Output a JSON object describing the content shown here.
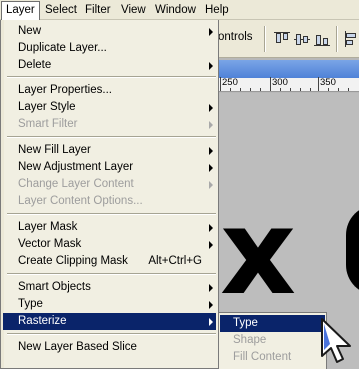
{
  "menubar": {
    "items": [
      {
        "label": "Layer",
        "active": true
      },
      {
        "label": "Select"
      },
      {
        "label": "Filter"
      },
      {
        "label": "View"
      },
      {
        "label": "Window"
      },
      {
        "label": "Help"
      }
    ]
  },
  "optionsbar": {
    "label": "ontrols",
    "align_icons": [
      "align-top-edges-icon",
      "align-vertical-centers-icon",
      "align-bottom-edges-icon",
      "align-left-edges-icon"
    ]
  },
  "ruler": {
    "labels": [
      "250",
      "300",
      "350"
    ]
  },
  "canvas": {
    "text": "x"
  },
  "layer_menu": {
    "items": [
      {
        "label": "New",
        "submenu": true
      },
      {
        "label": "Duplicate Layer..."
      },
      {
        "label": "Delete",
        "submenu": true
      },
      {
        "label": "Layer Properties..."
      },
      {
        "label": "Layer Style",
        "submenu": true
      },
      {
        "label": "Smart Filter",
        "submenu": true,
        "disabled": true
      },
      {
        "label": "New Fill Layer",
        "submenu": true
      },
      {
        "label": "New Adjustment Layer",
        "submenu": true
      },
      {
        "label": "Change Layer Content",
        "submenu": true,
        "disabled": true
      },
      {
        "label": "Layer Content Options...",
        "disabled": true
      },
      {
        "label": "Layer Mask",
        "submenu": true
      },
      {
        "label": "Vector Mask",
        "submenu": true
      },
      {
        "label": "Create Clipping Mask",
        "shortcut": "Alt+Ctrl+G"
      },
      {
        "label": "Smart Objects",
        "submenu": true
      },
      {
        "label": "Type",
        "submenu": true
      },
      {
        "label": "Rasterize",
        "submenu": true,
        "selected": true
      },
      {
        "label": "New Layer Based Slice"
      }
    ]
  },
  "rasterize_submenu": {
    "items": [
      {
        "label": "Type",
        "selected": true
      },
      {
        "label": "Shape",
        "disabled": true
      },
      {
        "label": "Fill Content",
        "disabled": true
      }
    ]
  },
  "colors": {
    "selection": "#0a246a",
    "menu_bg": "#f1efe2",
    "chrome": "#ece9d8",
    "disabled_text": "#9d9d9d"
  }
}
